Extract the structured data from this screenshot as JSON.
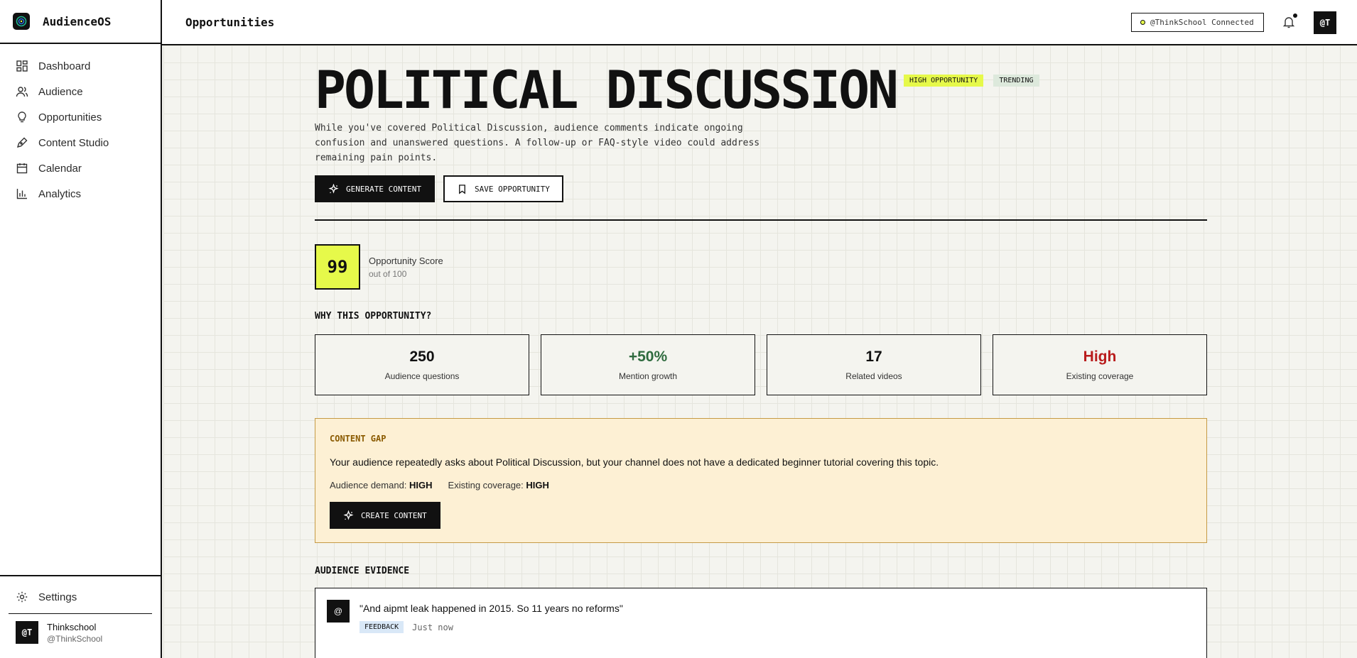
{
  "app": {
    "name": "AudienceOS"
  },
  "sidebar": {
    "items": [
      {
        "label": "Dashboard",
        "icon": "dashboard-icon"
      },
      {
        "label": "Audience",
        "icon": "users-icon"
      },
      {
        "label": "Opportunities",
        "icon": "lightbulb-icon"
      },
      {
        "label": "Content Studio",
        "icon": "pen-icon"
      },
      {
        "label": "Calendar",
        "icon": "calendar-icon"
      },
      {
        "label": "Analytics",
        "icon": "bar-chart-icon"
      }
    ],
    "settings_label": "Settings",
    "user": {
      "initials": "@T",
      "name": "Thinkschool",
      "handle": "@ThinkSchool"
    }
  },
  "header": {
    "title": "Opportunities",
    "connection": "@ThinkSchool Connected",
    "avatar": "@T"
  },
  "opportunity": {
    "title": "POLITICAL DISCUSSION",
    "badges": {
      "high": "HIGH OPPORTUNITY",
      "trending": "TRENDING"
    },
    "description": "While you've covered Political Discussion, audience comments indicate ongoing confusion and unanswered questions. A follow-up or FAQ-style video could address remaining pain points.",
    "generate_label": "GENERATE CONTENT",
    "save_label": "SAVE OPPORTUNITY",
    "score": {
      "value": "99",
      "label": "Opportunity Score",
      "sub": "out of 100"
    },
    "why_title": "WHY THIS OPPORTUNITY?",
    "stats": [
      {
        "value": "250",
        "label": "Audience questions",
        "color": "#111111"
      },
      {
        "value": "+50%",
        "label": "Mention growth",
        "color": "#2f6b3f"
      },
      {
        "value": "17",
        "label": "Related videos",
        "color": "#111111"
      },
      {
        "value": "High",
        "label": "Existing coverage",
        "color": "#b91c1c"
      }
    ],
    "gap": {
      "title": "CONTENT GAP",
      "body": "Your audience repeatedly asks about Political Discussion, but your channel does not have a dedicated beginner tutorial covering this topic.",
      "demand_label": "Audience demand:",
      "demand_value": "HIGH",
      "coverage_label": "Existing coverage:",
      "coverage_value": "HIGH",
      "button_label": "CREATE CONTENT"
    },
    "evidence_title": "AUDIENCE EVIDENCE",
    "evidence": [
      {
        "avatar": "@",
        "quote": "\"And aipmt leak happened in 2015. So 11 years no reforms\"",
        "tag": "FEEDBACK",
        "time": "Just now"
      }
    ]
  },
  "colors": {
    "accent": "#e6f94a",
    "dark": "#111111",
    "gap_bg": "#fdf0d4",
    "positive": "#2f6b3f",
    "negative": "#b91c1c"
  }
}
